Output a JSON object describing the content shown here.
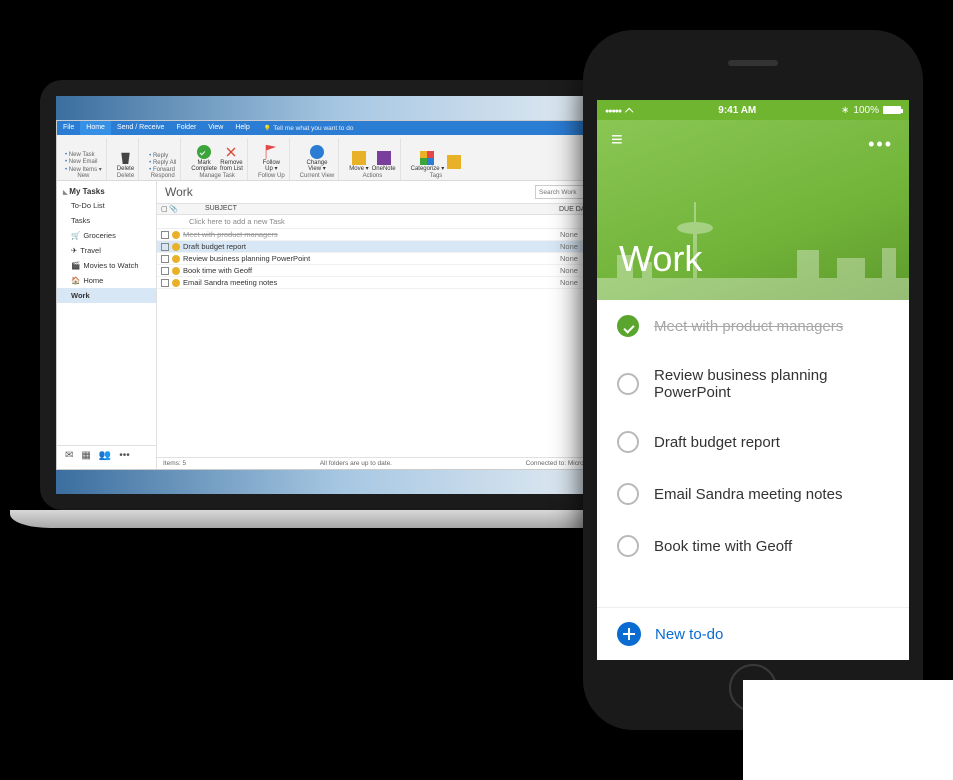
{
  "outlook": {
    "tabs": {
      "file": "File",
      "home": "Home",
      "send_receive": "Send / Receive",
      "folder": "Folder",
      "view": "View",
      "help": "Help",
      "tell_me": "Tell me what you want to do"
    },
    "ribbon": {
      "new": {
        "label": "New",
        "new_task": "New Task",
        "new_email": "New Email",
        "new_items": "New Items ▾"
      },
      "delete": {
        "label": "Delete",
        "button": "Delete"
      },
      "respond": {
        "label": "Respond",
        "reply": "Reply",
        "reply_all": "Reply All",
        "forward": "Forward"
      },
      "manage": {
        "label": "Manage Task",
        "mark_complete": "Mark\nComplete",
        "remove": "Remove\nfrom List"
      },
      "follow": {
        "label": "Follow Up",
        "button": "Follow\nUp ▾"
      },
      "current_view": {
        "label": "Current View",
        "button": "Change\nView ▾"
      },
      "actions": {
        "label": "Actions",
        "move": "Move ▾",
        "onenote": "OneNote"
      },
      "tags": {
        "label": "Tags",
        "categorize": "Categorize ▾",
        "private": ""
      }
    },
    "sidebar": {
      "header": "My Tasks",
      "items": [
        {
          "label": "To-Do List",
          "icon": ""
        },
        {
          "label": "Tasks",
          "icon": ""
        },
        {
          "label": "Groceries",
          "icon": "🛒"
        },
        {
          "label": "Travel",
          "icon": "✈"
        },
        {
          "label": "Movies to Watch",
          "icon": "🎬"
        },
        {
          "label": "Home",
          "icon": "🏠"
        },
        {
          "label": "Work",
          "icon": "",
          "selected": true
        }
      ]
    },
    "main": {
      "title": "Work",
      "search_placeholder": "Search Work",
      "col_subject": "SUBJECT",
      "col_due": "DUE DATE ▴",
      "add_placeholder": "Click here to add a new Task",
      "tasks": [
        {
          "text": "Meet with product managers",
          "due": "None",
          "done": true
        },
        {
          "text": "Draft budget report",
          "due": "None",
          "selected": true
        },
        {
          "text": "Review business planning PowerPoint",
          "due": "None"
        },
        {
          "text": "Book time with Geoff",
          "due": "None"
        },
        {
          "text": "Email Sandra meeting notes",
          "due": "None"
        }
      ]
    },
    "status": {
      "items": "Items: 5",
      "folders": "All folders are up to date.",
      "connected": "Connected to: Microsoft Exch…"
    }
  },
  "phone": {
    "status": {
      "time": "9:41 AM",
      "battery": "100%"
    },
    "hero": {
      "title": "Work"
    },
    "todos": [
      {
        "text": "Meet with product managers",
        "done": true
      },
      {
        "text": "Review business planning PowerPoint",
        "done": false
      },
      {
        "text": "Draft budget report",
        "done": false
      },
      {
        "text": "Email Sandra meeting notes",
        "done": false
      },
      {
        "text": "Book time with Geoff",
        "done": false
      }
    ],
    "new_todo": "New to-do"
  }
}
